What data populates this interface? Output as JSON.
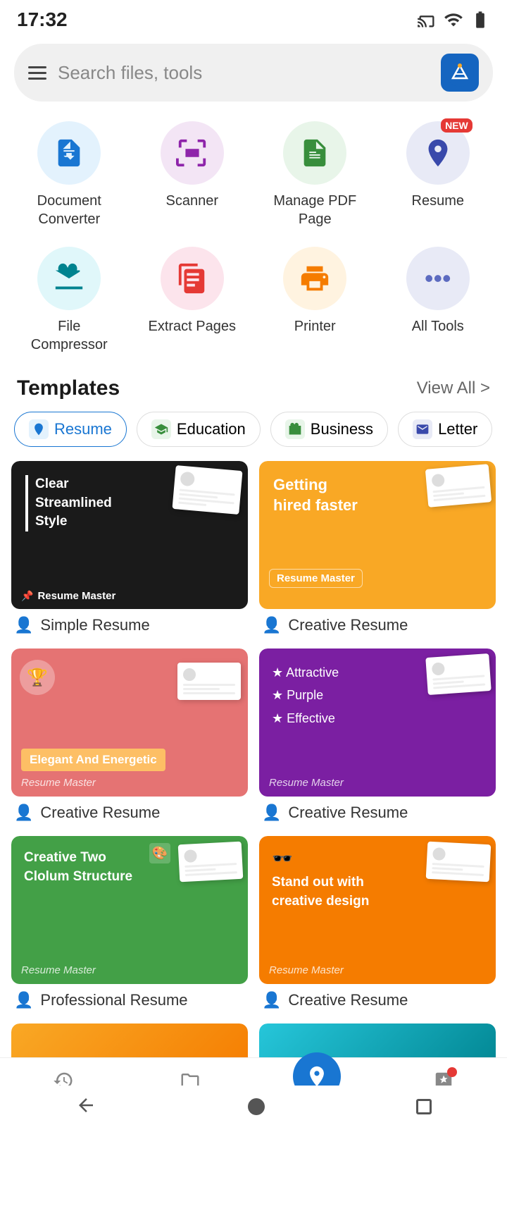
{
  "statusBar": {
    "time": "17:32"
  },
  "search": {
    "placeholder": "Search files, tools"
  },
  "tools": [
    {
      "id": "doc-converter",
      "label": "Document\nConverter",
      "bgColor": "#e3f2fd",
      "iconColor": "#1976d2",
      "badge": null
    },
    {
      "id": "scanner",
      "label": "Scanner",
      "bgColor": "#f3e5f5",
      "iconColor": "#8e24aa",
      "badge": null
    },
    {
      "id": "manage-pdf",
      "label": "Manage PDF\nPage",
      "bgColor": "#e8f5e9",
      "iconColor": "#388e3c",
      "badge": null
    },
    {
      "id": "resume",
      "label": "Resume",
      "bgColor": "#e8eaf6",
      "iconColor": "#3949ab",
      "badge": "NEW"
    },
    {
      "id": "file-compressor",
      "label": "File\nCompressor",
      "bgColor": "#e0f7fa",
      "iconColor": "#00838f",
      "badge": null
    },
    {
      "id": "extract-pages",
      "label": "Extract Pages",
      "bgColor": "#fce4ec",
      "iconColor": "#e53935",
      "badge": null
    },
    {
      "id": "printer",
      "label": "Printer",
      "bgColor": "#fff3e0",
      "iconColor": "#f57c00",
      "badge": null
    },
    {
      "id": "all-tools",
      "label": "All Tools",
      "bgColor": "#e8eaf6",
      "iconColor": "#5c6bc0",
      "badge": null
    }
  ],
  "templates": {
    "title": "Templates",
    "viewAll": "View All >",
    "tabs": [
      {
        "id": "resume",
        "label": "Resume",
        "active": true
      },
      {
        "id": "education",
        "label": "Education",
        "active": false
      },
      {
        "id": "business",
        "label": "Business",
        "active": false
      },
      {
        "id": "letter",
        "label": "Letter",
        "active": false
      }
    ],
    "cards": [
      {
        "id": "simple-resume",
        "name": "Simple Resume",
        "thumbClass": "thumb-black",
        "topText": "Clear\nStreamlined\nStyle",
        "badge": "Resume Master"
      },
      {
        "id": "creative-resume-1",
        "name": "Creative Resume",
        "thumbClass": "thumb-yellow",
        "topText": "Getting\nhired faster",
        "badge": "Resume Master"
      },
      {
        "id": "creative-resume-2",
        "name": "Creative Resume",
        "thumbClass": "thumb-salmon",
        "topText": "Elegant And Energetic",
        "badge": "Resume Master"
      },
      {
        "id": "creative-resume-3",
        "name": "Creative Resume",
        "thumbClass": "thumb-purple",
        "topText": "★ Attractive\n★ Purple\n★ Effective",
        "badge": "Resume Master"
      },
      {
        "id": "professional-resume",
        "name": "Professional Resume",
        "thumbClass": "thumb-green",
        "topText": "Creative Two\nClolum Structure",
        "badge": "Resume Master"
      },
      {
        "id": "creative-resume-4",
        "name": "Creative Resume",
        "thumbClass": "thumb-orange",
        "topText": "Stand out with\ncreative design",
        "badge": "Resume Master"
      }
    ]
  },
  "bottomNav": [
    {
      "id": "recent",
      "label": "Recent",
      "active": false
    },
    {
      "id": "files",
      "label": "Files",
      "active": false
    },
    {
      "id": "discover",
      "label": "Discover",
      "active": true
    },
    {
      "id": "wps-pro",
      "label": "WPS Pro",
      "active": false,
      "badge": true
    }
  ]
}
